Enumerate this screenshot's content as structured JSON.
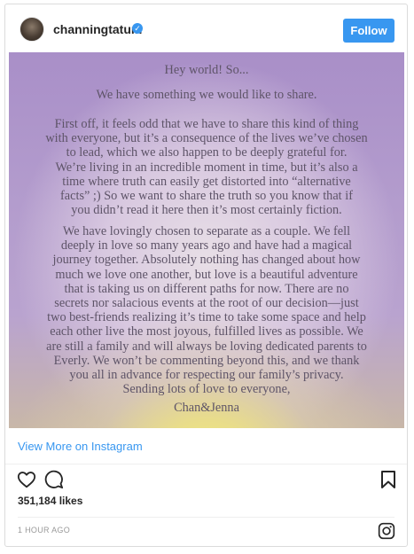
{
  "header": {
    "username": "channingtatum",
    "verified_glyph": "✓",
    "follow_label": "Follow"
  },
  "letter": {
    "greeting": "Hey world!   So...",
    "share": "We have something we would like to share.",
    "paragraph1": [
      "First off, it feels odd that we have to share this kind of thing",
      "with everyone, but it’s a consequence of the lives we’ve chosen",
      "to lead, which we also happen to be deeply grateful for.",
      "We’re living in an incredible moment in time, but it’s also a",
      "time where truth can easily get distorted into “alternative",
      "facts” ;)    So we want to share the truth so you know that if",
      "you didn’t read it here then it’s most certainly fiction."
    ],
    "paragraph2": [
      "We have lovingly chosen to separate as a couple.    We fell",
      "deeply in love so many years ago and have had a magical",
      "journey together.    Absolutely nothing has changed about how",
      "much we love one another, but love is a beautiful adventure",
      "that is taking us on different paths for now.    There are no",
      "secrets nor salacious events at the root of our decision—just",
      "two best-friends realizing it’s time to take some space and help",
      "each other live the most joyous, fulfilled lives as possible.   We",
      "are still a family and will always be loving dedicated parents to",
      "Everly. We won’t be commenting beyond this, and we thank",
      "you all in advance for respecting our family’s privacy.",
      "Sending lots of love to everyone,"
    ],
    "signature": "Chan&Jenna"
  },
  "footer": {
    "view_more_label": "View More on Instagram",
    "likes": "351,184 likes",
    "timestamp": "1 HOUR AGO"
  },
  "icons": {
    "heart": "heart-icon",
    "comment": "comment-icon",
    "bookmark": "bookmark-icon",
    "instagram": "instagram-logo-icon",
    "verified": "verified-badge-icon"
  },
  "colors": {
    "accent": "#3897f0",
    "text": "#262626",
    "muted": "#999999",
    "letter_ink": "#5e5468"
  }
}
